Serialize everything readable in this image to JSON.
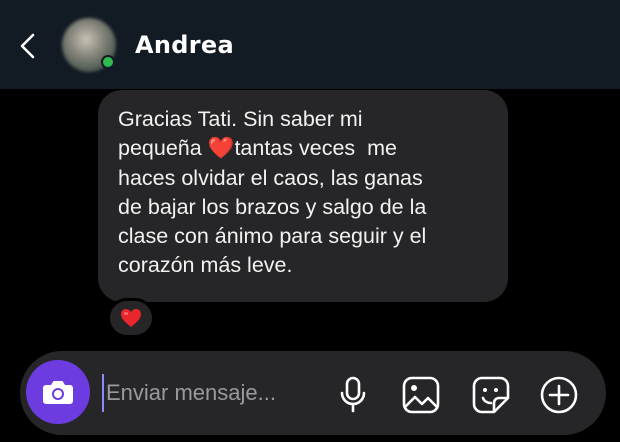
{
  "header": {
    "contact_name": "Andrea",
    "icons": {
      "back": "chevron-left-icon",
      "avatar": "avatar",
      "presence": "online-indicator"
    }
  },
  "message": {
    "text": "Gracias Tati. Sin saber mi\npequeña ❤️‍tantas veces  me\nhaces olvidar el caos, las ganas\nde bajar los brazos y salgo de la\nclase con ánimo para seguir y el\ncorazón más leve.",
    "reaction": "❤️"
  },
  "composer": {
    "placeholder": "Enviar mensaje...",
    "icons": [
      "camera-icon",
      "microphone-icon",
      "image-icon",
      "sticker-icon",
      "plus-circle-icon"
    ]
  },
  "colors": {
    "header_bg": "#121a24",
    "bubble_bg": "#262628",
    "camera_accent": "#6c3ce0",
    "presence_green": "#2fbd4f"
  }
}
